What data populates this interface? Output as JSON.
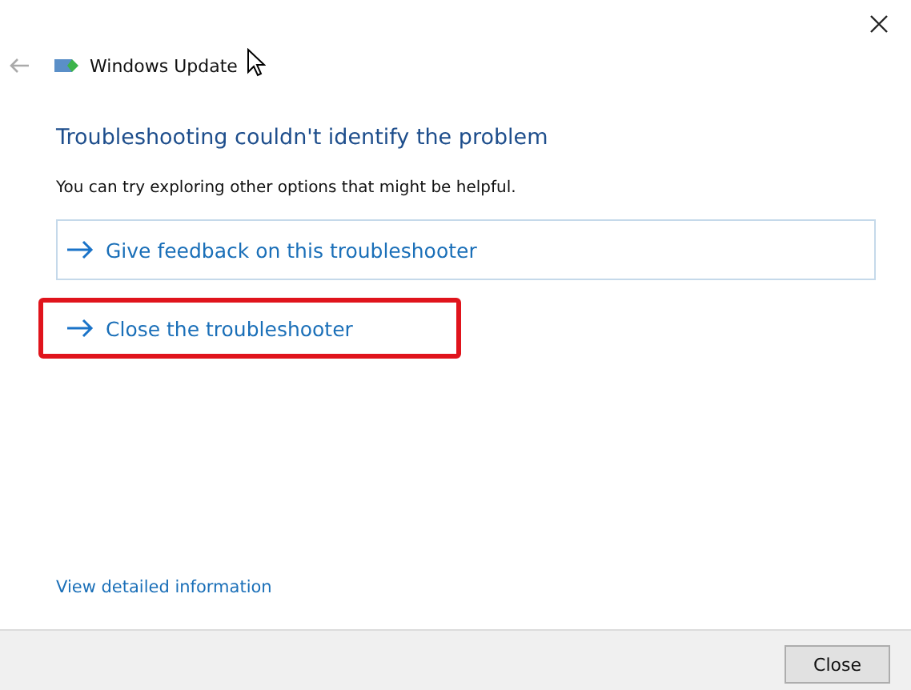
{
  "window": {
    "title": "Windows Update"
  },
  "heading": "Troubleshooting couldn't identify the problem",
  "message": "You can try exploring other options that might be helpful.",
  "options": [
    {
      "label": "Give feedback on this troubleshooter",
      "kind": "boxed",
      "highlighted": false
    },
    {
      "label": "Close the troubleshooter",
      "kind": "plain",
      "highlighted": true
    }
  ],
  "details_link": "View detailed information",
  "footer": {
    "button": "Close"
  }
}
